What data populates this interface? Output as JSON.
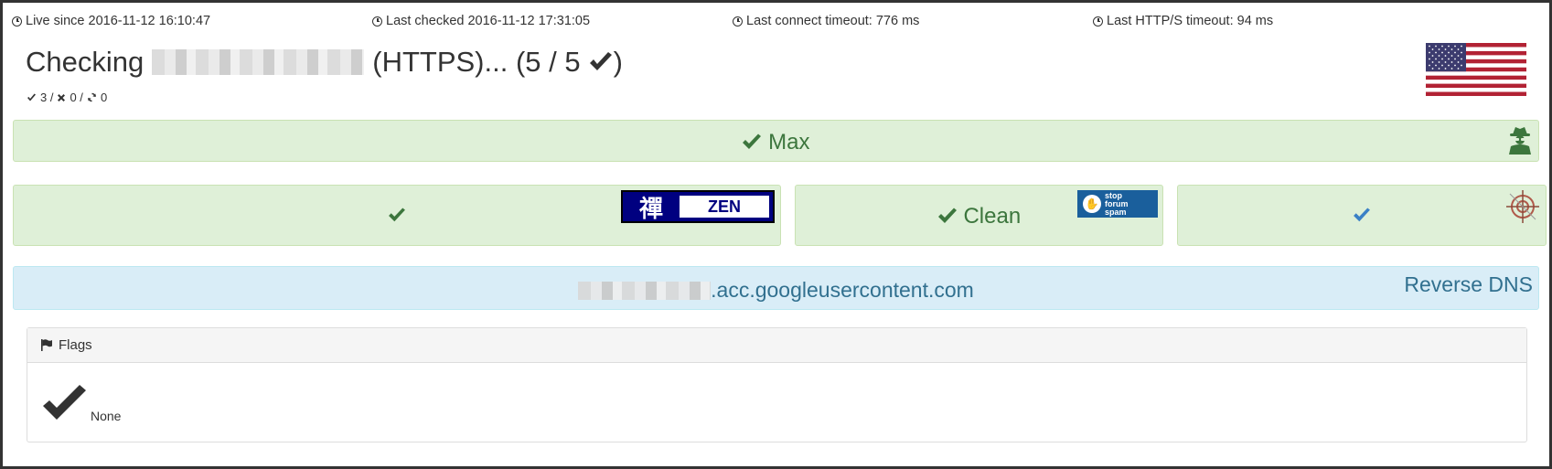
{
  "status": {
    "live_since": "Live since 2016-11-12 16:10:47",
    "last_checked": "Last checked 2016-11-12 17:31:05",
    "last_connect_timeout": "Last connect timeout: 776 ms",
    "last_https_timeout": "Last HTTP/S timeout: 94 ms"
  },
  "heading": {
    "prefix": "Checking",
    "suffix": "(HTTPS)... (5 / 5",
    "close": ")"
  },
  "counts": {
    "ok": "3 /",
    "fail": "0 /",
    "retry": "0"
  },
  "anonymity": {
    "label": "Max"
  },
  "checks": {
    "zen": {
      "logo_kanji": "禪",
      "logo_word": "ZEN"
    },
    "sfs": {
      "label": "Clean",
      "logo_lines": [
        "stop",
        "forum",
        "spam"
      ]
    }
  },
  "reverse_dns": {
    "host_suffix": ".acc.googleusercontent.com",
    "title": "Reverse DNS"
  },
  "flags": {
    "title": "Flags",
    "value": "None"
  },
  "colors": {
    "success_bg": "#dff0d8",
    "success_text": "#3c763d",
    "info_bg": "#d9edf7",
    "info_text": "#31708f"
  }
}
